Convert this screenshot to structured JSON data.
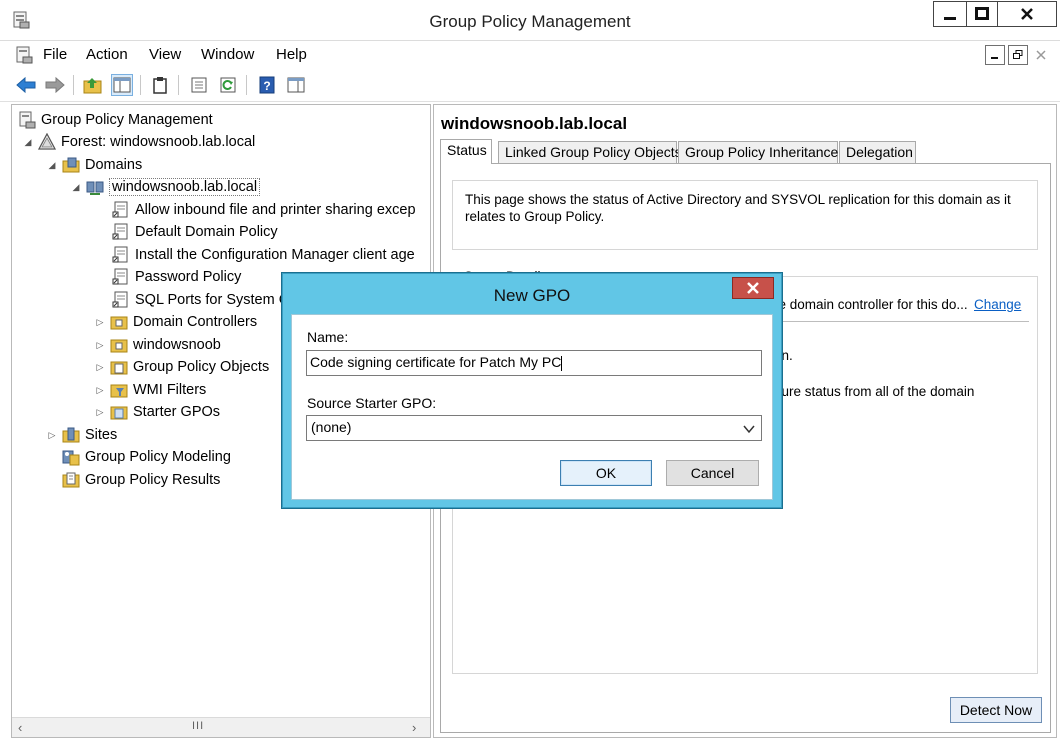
{
  "window": {
    "title": "Group Policy Management",
    "controls": {
      "minimize": "‒",
      "maximize": "□",
      "close": "✕"
    }
  },
  "menubar": {
    "items": [
      "File",
      "Action",
      "View",
      "Window",
      "Help"
    ]
  },
  "tree": {
    "root": "Group Policy Management",
    "forest": "Forest: windowsnoob.lab.local",
    "domains": "Domains",
    "domain": "windowsnoob.lab.local",
    "gpo_links": [
      "Allow inbound file and printer sharing excep",
      "Default Domain Policy",
      "Install the Configuration Manager client age",
      "Password Policy",
      "SQL Ports for System C"
    ],
    "containers": [
      "Domain Controllers",
      "windowsnoob",
      "Group Policy Objects",
      "WMI Filters",
      "Starter GPOs"
    ],
    "sites": "Sites",
    "modeling": "Group Policy Modeling",
    "results": "Group Policy Results"
  },
  "right_pane": {
    "heading": "windowsnoob.lab.local",
    "tabs": [
      "Status",
      "Linked Group Policy Objects",
      "Group Policy Inheritance",
      "Delegation"
    ],
    "active_tab": "Status",
    "info_text_1": "This page shows the status of Active Directory and SYSVOL replication for this domain as it",
    "info_text_2": "relates to Group Policy.",
    "status_legend": "Status Details",
    "status_line_1": "he domain controller for this do...",
    "change_link": "Change",
    "status_line_2": "ain.",
    "status_line_3": "cture status from all of the domain",
    "detect_button": "Detect Now"
  },
  "dialog": {
    "title": "New GPO",
    "close": "✕",
    "name_label": "Name:",
    "name_value": "Code signing certificate for Patch My PC",
    "starter_label": "Source Starter GPO:",
    "starter_value": "(none)",
    "ok_label": "OK",
    "cancel_label": "Cancel"
  },
  "scrollbar": {
    "grip": "III"
  },
  "colors": {
    "dialog_frame": "#61c6e6",
    "close_button": "#c7514a",
    "link": "#0a5fc4"
  }
}
